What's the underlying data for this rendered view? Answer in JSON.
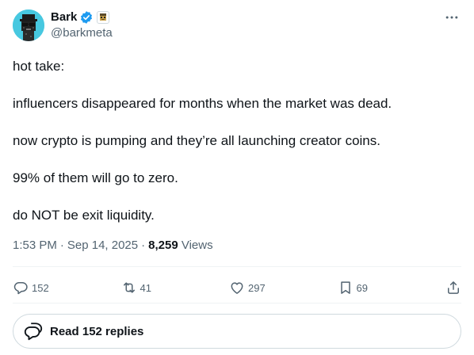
{
  "author": {
    "display_name": "Bark",
    "handle": "@barkmeta"
  },
  "tweet": {
    "paragraphs": [
      "hot take:",
      "influencers disappeared for months when the market was dead.",
      "now crypto is pumping and they’re all launching creator coins.",
      "99% of them will go to zero.",
      "do NOT be exit liquidity."
    ],
    "time": "1:53 PM",
    "sep1": "·",
    "date": "Sep 14, 2025",
    "sep2": "·",
    "views_count": "8,259",
    "views_label": "Views"
  },
  "actions": {
    "replies": "152",
    "retweets": "41",
    "likes": "297",
    "bookmarks": "69"
  },
  "read_replies_label": "Read 152 replies",
  "colors": {
    "text": "#0f1419",
    "muted": "#536471",
    "border": "#cfd9de",
    "verified": "#1d9bf0",
    "avatar_bg": "#47c8e0"
  },
  "icons": [
    "verified-badge-icon",
    "affiliate-badge-icon",
    "more-icon",
    "reply-icon",
    "retweet-icon",
    "like-icon",
    "bookmark-icon",
    "share-icon",
    "speech-bubbles-icon"
  ]
}
